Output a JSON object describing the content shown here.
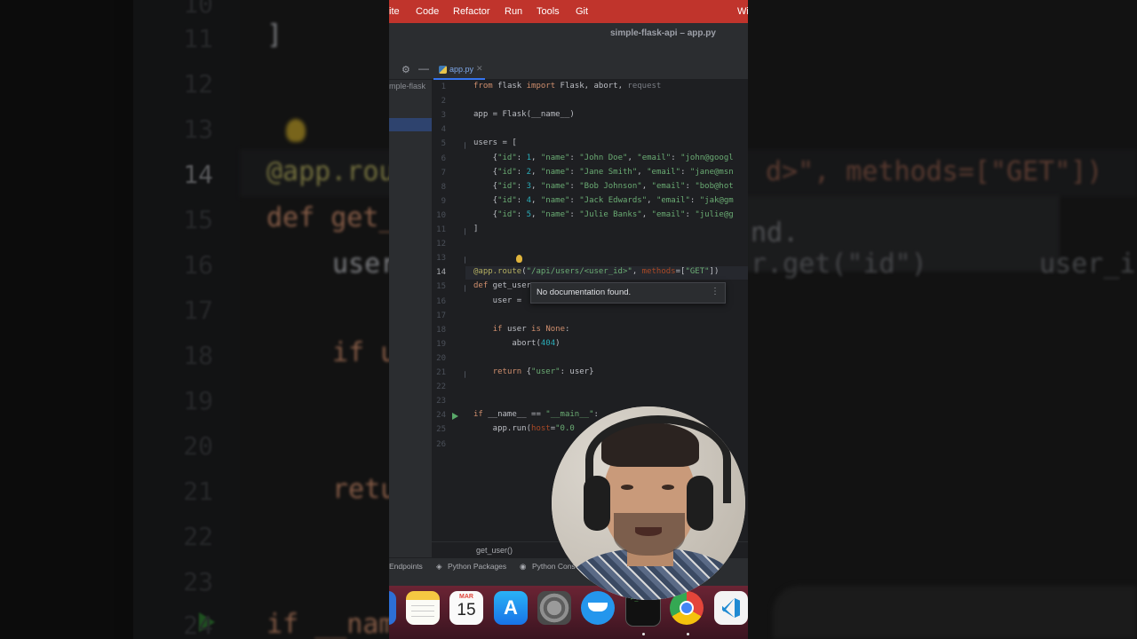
{
  "menubar": {
    "items": [
      "ite",
      "Code",
      "Refactor",
      "Run",
      "Tools",
      "Git",
      "Wi"
    ]
  },
  "window": {
    "title": "simple-flask-api – app.py"
  },
  "tabs": [
    {
      "label": "app.py",
      "active": true
    }
  ],
  "project": {
    "breadcrumb": "mple-flask"
  },
  "editor": {
    "current_line": 14,
    "line_numbers": [
      "1",
      "2",
      "3",
      "4",
      "5",
      "6",
      "7",
      "8",
      "9",
      "10",
      "11",
      "12",
      "13",
      "14",
      "15",
      "16",
      "17",
      "18",
      "19",
      "20",
      "21",
      "22",
      "23",
      "24",
      "25",
      "26"
    ],
    "lines": [
      "from flask import Flask, abort, request",
      "",
      "app = Flask(__name__)",
      "",
      "users = [",
      "    {\"id\": 1, \"name\": \"John Doe\", \"email\": \"john@googl",
      "    {\"id\": 2, \"name\": \"Jane Smith\", \"email\": \"jane@msn",
      "    {\"id\": 3, \"name\": \"Bob Johnson\", \"email\": \"bob@hot",
      "    {\"id\": 4, \"name\": \"Jack Edwards\", \"email\": \"jak@gm",
      "    {\"id\": 5, \"name\": \"Julie Banks\", \"email\": \"julie@g",
      "]",
      "",
      "",
      "@app.route(\"/api/users/<user_id>\", methods=[\"GET\"])",
      "def get_user",
      "    user = ",
      "",
      "    if user is None:",
      "        abort(404)",
      "",
      "    return {\"user\": user}",
      "",
      "",
      "if __name__ == \"__main__\":",
      "    app.run(host=\"0.0",
      ""
    ],
    "line16_tail": "user_i",
    "line25_tail": "ue)"
  },
  "doc_popup": {
    "text": "No documentation found."
  },
  "status": {
    "breadcrumb": "get_user()"
  },
  "toolwindows": [
    "Endpoints",
    "Python Packages",
    "Python Cons"
  ],
  "dock": {
    "calendar_month": "MAR",
    "calendar_day": "15",
    "apps": [
      "notes",
      "calendar",
      "app-store",
      "system-settings",
      "docker",
      "terminal",
      "chrome",
      "vscode"
    ]
  },
  "background_zoom": {
    "line_numbers": [
      "10",
      "11",
      "12",
      "13",
      "14",
      "15",
      "16",
      "17",
      "18",
      "19",
      "20",
      "21",
      "22",
      "23",
      "24"
    ],
    "fragments": [
      "]",
      "@app.rou",
      "d>\", methods=[\"GET\"])",
      "def get_",
      "nd.",
      "user",
      "r.get(\"id\")",
      "user_i",
      "if u",
      "retu",
      "if __nam"
    ]
  },
  "colors": {
    "menubar": "#c0342c",
    "editor_bg": "#1e1f22",
    "keyword": "#cf8e6d",
    "string": "#6aab73",
    "decorator": "#b3ae60",
    "number": "#2aacb8",
    "accent": "#3574f0"
  }
}
